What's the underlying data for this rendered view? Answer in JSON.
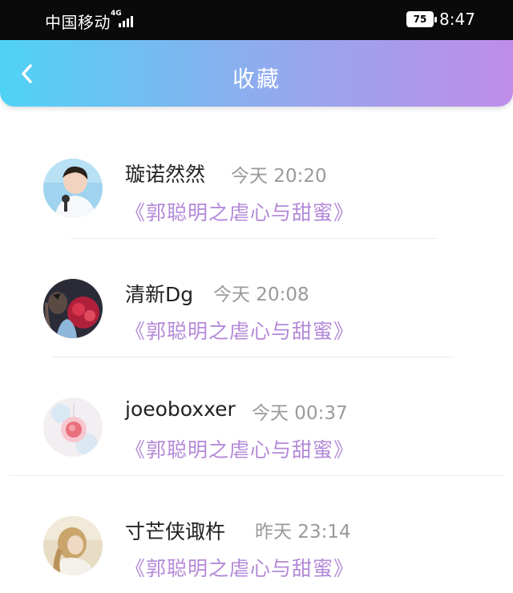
{
  "status_bar": {
    "carrier": "中国移动",
    "network": "4G",
    "battery": "75",
    "time": "8:47"
  },
  "nav": {
    "back_icon": "chevron-left-icon",
    "title": "收藏"
  },
  "favorites": [
    {
      "user": "璇诺然然",
      "time": "今天 20:20",
      "title": "《郭聪明之虐心与甜蜜》"
    },
    {
      "user": "清新Dg",
      "time": "今天 20:08",
      "title": "《郭聪明之虐心与甜蜜》"
    },
    {
      "user": "joeoboxxer",
      "time": "今天 00:37",
      "title": "《郭聪明之虐心与甜蜜》"
    },
    {
      "user": "寸芒侠诹杵",
      "time": "昨天 23:14",
      "title": "《郭聪明之虐心与甜蜜》"
    }
  ],
  "colors": {
    "gradient_start": "#4fd2f6",
    "gradient_end": "#bf8de9",
    "title_purple": "#b389d8",
    "time_gray": "#9a9a9a"
  }
}
